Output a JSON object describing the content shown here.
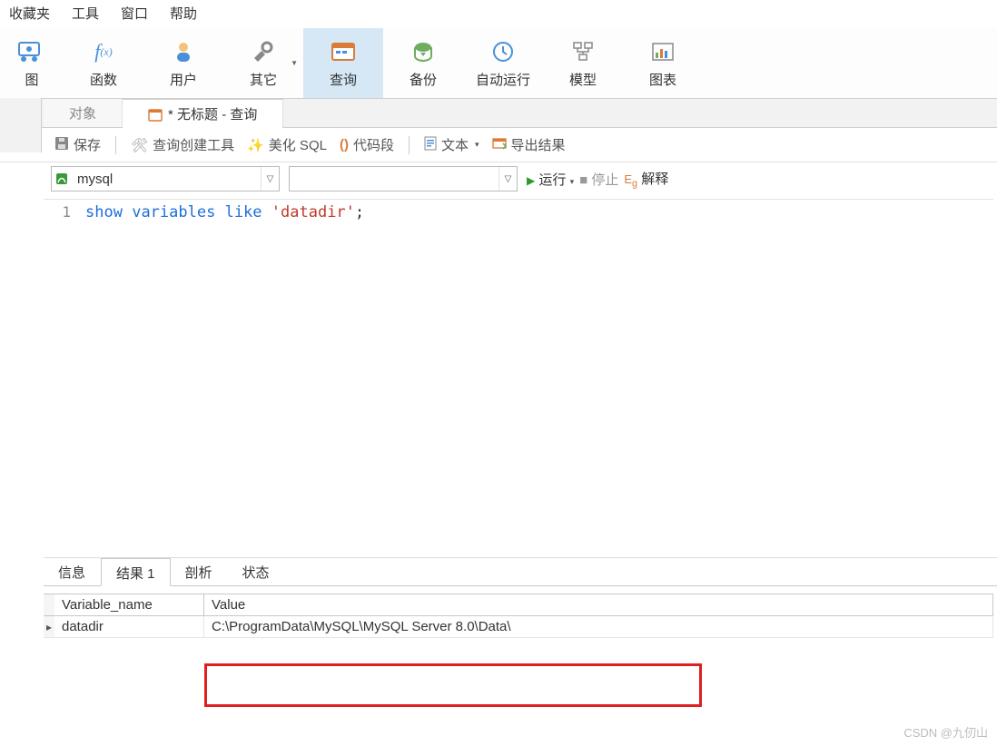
{
  "menubar": {
    "favorites": "收藏夹",
    "tools": "工具",
    "window": "窗口",
    "help": "帮助"
  },
  "ribbon": {
    "view": "图",
    "function": "函数",
    "user": "用户",
    "other": "其它",
    "query": "查询",
    "backup": "备份",
    "schedule": "自动运行",
    "model": "模型",
    "chart": "图表"
  },
  "tabs": {
    "objects": "对象",
    "untitled": "* 无标题 - 查询"
  },
  "toolbar": {
    "save": "保存",
    "query_builder": "查询创建工具",
    "beautify": "美化 SQL",
    "snippets": "代码段",
    "text": "文本",
    "export": "导出结果"
  },
  "connection": {
    "db_combo": "mysql",
    "schema_combo": "",
    "run": "运行",
    "stop": "停止",
    "explain": "解释"
  },
  "editor": {
    "line_no": "1",
    "tok_show": "show",
    "tok_variables": "variables",
    "tok_like": "like",
    "tok_str": "'datadir'",
    "tok_semi": ";"
  },
  "result_tabs": {
    "info": "信息",
    "result1": "结果 1",
    "profile": "剖析",
    "status": "状态"
  },
  "grid": {
    "col_variable": "Variable_name",
    "col_value": "Value",
    "row0_variable": "datadir",
    "row0_value": "C:\\ProgramData\\MySQL\\MySQL Server 8.0\\Data\\"
  },
  "watermark": "CSDN @九仞山"
}
